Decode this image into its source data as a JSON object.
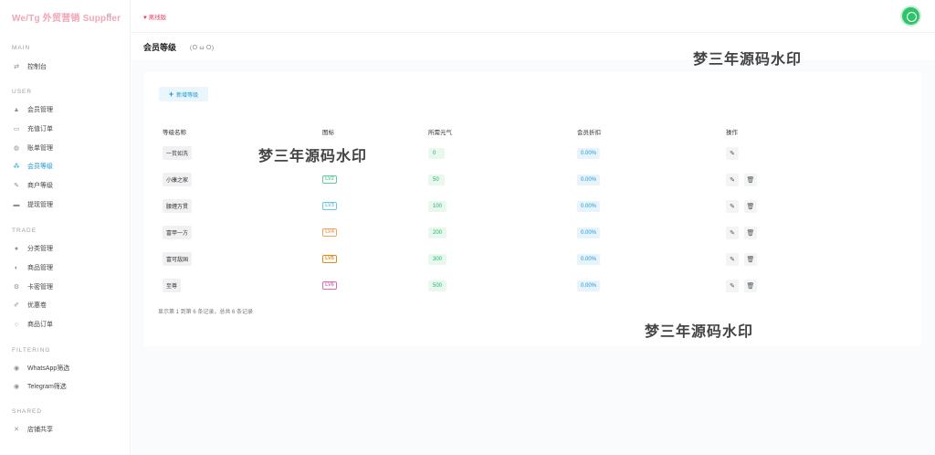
{
  "brand": {
    "title": "We/Tg 外贸营销 Supplier"
  },
  "sidebar": {
    "sections": [
      {
        "label": "MAIN",
        "items": [
          {
            "label": "控制台",
            "icon": "dashboard-icon"
          }
        ]
      },
      {
        "label": "USER",
        "items": [
          {
            "label": "会员管理",
            "icon": "user-icon"
          },
          {
            "label": "充值订单",
            "icon": "recharge-icon"
          },
          {
            "label": "账单管理",
            "icon": "bill-icon"
          },
          {
            "label": "会员等级",
            "icon": "level-icon",
            "active": true
          },
          {
            "label": "商户等级",
            "icon": "merchant-level-icon"
          },
          {
            "label": "提现管理",
            "icon": "withdraw-icon"
          }
        ]
      },
      {
        "label": "TRADE",
        "items": [
          {
            "label": "分类管理",
            "icon": "category-icon"
          },
          {
            "label": "商品管理",
            "icon": "goods-icon"
          },
          {
            "label": "卡密管理",
            "icon": "card-icon"
          },
          {
            "label": "优惠卷",
            "icon": "coupon-icon"
          },
          {
            "label": "商品订单",
            "icon": "order-icon"
          }
        ]
      },
      {
        "label": "FILTERING",
        "items": [
          {
            "label": "WhatsApp筛选",
            "icon": "whatsapp-icon"
          },
          {
            "label": "Telegram筛选",
            "icon": "telegram-icon"
          }
        ]
      },
      {
        "label": "SHARED",
        "items": [
          {
            "label": "店铺共享",
            "icon": "share-icon"
          }
        ]
      }
    ]
  },
  "topbar": {
    "offline_label": "离线版"
  },
  "page": {
    "title": "会员等级",
    "subtitle": "(Ｏ ω Ｏ)"
  },
  "toolbar": {
    "add_label": "新增等级"
  },
  "table": {
    "headers": [
      "等级名称",
      "图标",
      "所需元气",
      "会员折扣",
      "操作"
    ],
    "rows": [
      {
        "name": "一贫如洗",
        "icon": "",
        "yuanqi": "0",
        "discount": "0.00%",
        "deletable": false
      },
      {
        "name": "小康之家",
        "icon": "LV2",
        "icon_color": "#5fcf9a",
        "yuanqi": "50",
        "discount": "0.00%",
        "deletable": true
      },
      {
        "name": "腰缠万贯",
        "icon": "LV3",
        "icon_color": "#6cc8e6",
        "yuanqi": "100",
        "discount": "0.00%",
        "deletable": true
      },
      {
        "name": "富甲一方",
        "icon": "LV4",
        "icon_color": "#f0a35a",
        "yuanqi": "200",
        "discount": "0.00%",
        "deletable": true
      },
      {
        "name": "富可敌国",
        "icon": "LV5",
        "icon_color": "#e08a1a",
        "yuanqi": "300",
        "discount": "0.00%",
        "deletable": true
      },
      {
        "name": "至尊",
        "icon": "LV6",
        "icon_color": "#d96bb6",
        "yuanqi": "500",
        "discount": "0.00%",
        "deletable": true
      }
    ]
  },
  "footer": {
    "summary": "显示第 1 到第 6 条记录，总共 6 条记录"
  },
  "watermark": {
    "text": "梦三年源码水印"
  }
}
